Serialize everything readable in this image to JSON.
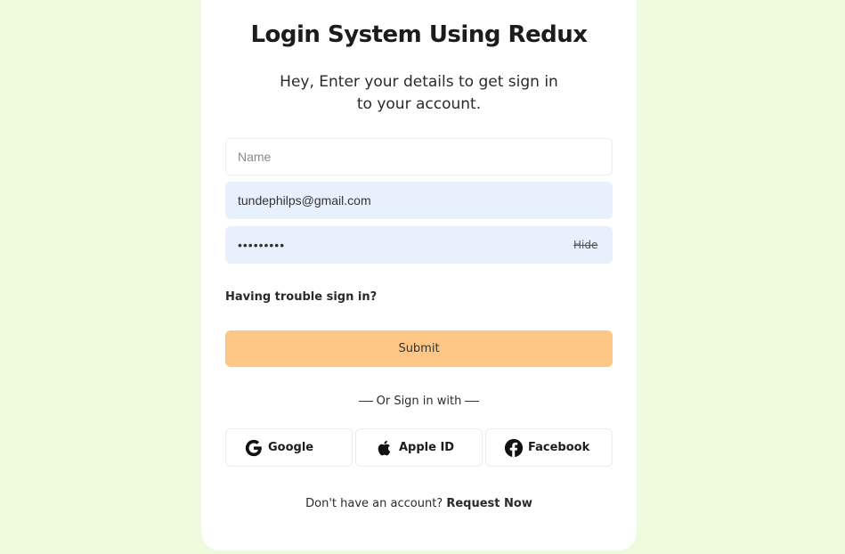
{
  "card": {
    "title": "Login System Using Redux",
    "subtitle_line1": "Hey, Enter your details to get sign in",
    "subtitle_line2": "to your account."
  },
  "form": {
    "name_placeholder": "Name",
    "name_value": "",
    "email_value": "tundephilps@gmail.com",
    "password_value": "•••••••••",
    "hide_label": "Hide",
    "trouble_label": "Having trouble sign in?",
    "submit_label": "Submit"
  },
  "social": {
    "divider_label": "Or Sign in with",
    "google_label": "Google",
    "apple_label": "Apple ID",
    "facebook_label": "Facebook"
  },
  "footer": {
    "prompt": "Don't have an account?",
    "link_label": "Request Now"
  },
  "colors": {
    "page_background": "#eefadc",
    "card_background": "#ffffff",
    "submit_background": "#fdc685",
    "autofill_background": "#e8f0fe"
  }
}
